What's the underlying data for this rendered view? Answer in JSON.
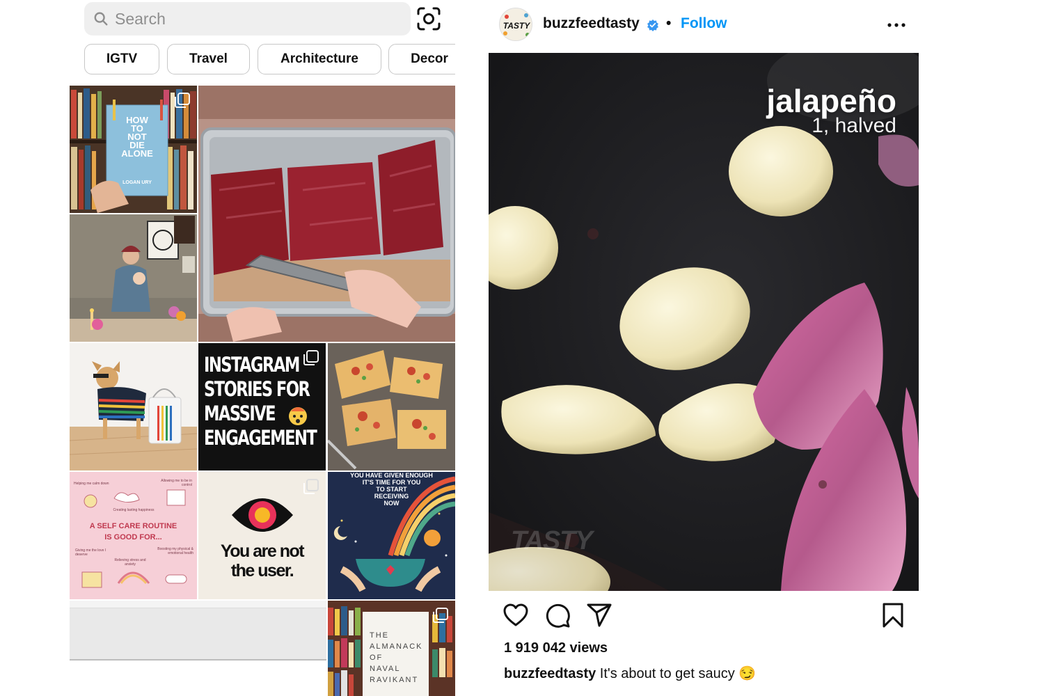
{
  "explore": {
    "search": {
      "placeholder": "Search"
    },
    "chips": [
      {
        "label": "IGTV"
      },
      {
        "label": "Travel"
      },
      {
        "label": "Architecture"
      },
      {
        "label": "Decor"
      }
    ],
    "tiles": {
      "book1": {
        "title_lines": [
          "HOW",
          "TO",
          "NOT",
          "DIE",
          "ALONE"
        ],
        "author": "LOGAN URY"
      },
      "stories": {
        "lines": [
          "INSTAGRAM",
          "STORIES FOR",
          "MASSIVE",
          "ENGAGEMENT"
        ]
      },
      "selfcare": {
        "title": "A SELF CARE ROUTINE",
        "subtitle": "IS GOOD FOR...",
        "notes": [
          "Helping me calm down",
          "Allowing me to be in control",
          "Creating lasting happiness",
          "Giving me the love I deserve",
          "Relieving stress and anxiety",
          "Boosting my physical & emotional health"
        ]
      },
      "notuser": {
        "line1": "You are not",
        "line2": "the user."
      },
      "rainbow": {
        "lines": [
          "YOU HAVE GIVEN ENOUGH",
          "IT'S TIME FOR YOU",
          "TO START",
          "RECEIVING",
          "NOW"
        ]
      },
      "almanack": {
        "lines": [
          "THE",
          "ALMANACK",
          "OF",
          "NAVAL",
          "RAVIKANT"
        ]
      }
    }
  },
  "post": {
    "username": "buzzfeedtasty",
    "separator": "•",
    "follow_label": "Follow",
    "overlay_title": "jalapeño",
    "overlay_subtitle": "1, halved",
    "watermark": "TASTY",
    "avatar_text": "TASTY",
    "views": "1 919 042 views",
    "caption_user": "buzzfeedtasty",
    "caption_text": " It's about to get saucy 😏",
    "icons": [
      "heart-icon",
      "comment-icon",
      "share-icon",
      "bookmark-icon"
    ],
    "colors": {
      "follow": "#0095f6",
      "verified": "#3897f0"
    }
  }
}
